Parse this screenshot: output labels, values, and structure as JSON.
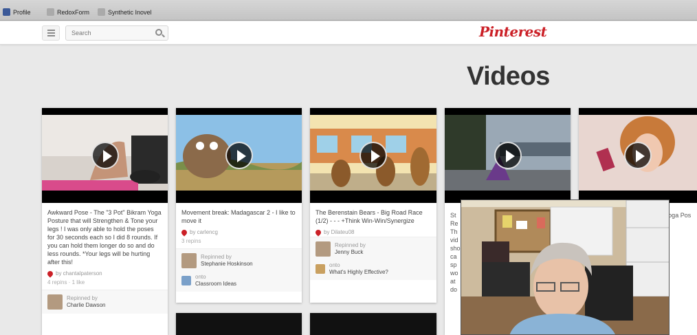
{
  "browser": {
    "bookmarks": [
      {
        "label": "Profile",
        "icon": "facebook-icon"
      },
      {
        "label": "RedoxForm",
        "icon": "page-icon"
      },
      {
        "label": "Synthetic Inovel",
        "icon": "page-icon"
      }
    ]
  },
  "header": {
    "search_placeholder": "Search",
    "logo": "Pinterest"
  },
  "page_title": "Videos",
  "pins": [
    {
      "description": "Awkward Pose - The \"3 Pot\" Bikram Yoga Posture that will Strengthen & Tone your legs ! I was only able to hold the poses for 30 seconds each so I did 8 rounds. If you can hold them longer do so and do less rounds. *Your legs will be hurting after this!",
      "by": "by chantalpaterson",
      "stats": "4 repins · 1 like",
      "repinned_label": "Repinned by",
      "repinned_name": "Charlie Dawson"
    },
    {
      "description": "Movement break: Madagascar 2 - I like to move it",
      "by": "by carlencg",
      "stats": "3 repins",
      "repinned_label": "Repinned by",
      "repinned_name": "Stephanie Hoskinson",
      "board_label": "onto",
      "board_name": "Classroom Ideas"
    },
    {
      "description": "The Berenstain Bears - Big Road Race (1/2) - - - +Think Win-Win/Synergize",
      "by": "by Dilateu08",
      "stats": "",
      "repinned_label": "Repinned by",
      "repinned_name": "Jenny Buck",
      "board_label": "onto",
      "board_name": "What's Highly Effective?"
    }
  ],
  "partial": {
    "col4": "St\nRe\nTh\nvid\nsho\nca\nsp\nwo\nat\ndo",
    "col5": "Yoga Pos"
  },
  "colors": {
    "brand": "#cb2027",
    "background": "#e9e9e9"
  }
}
